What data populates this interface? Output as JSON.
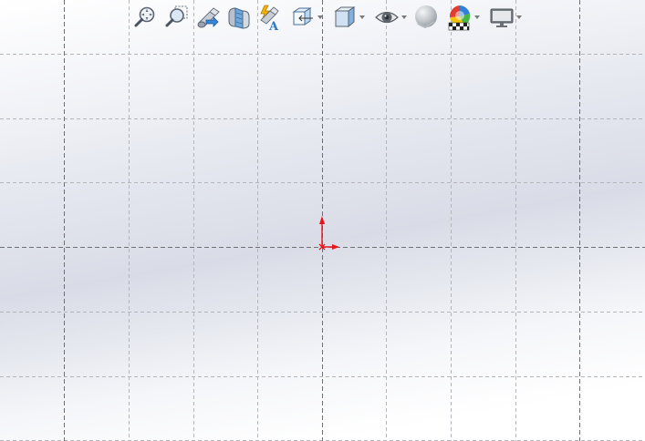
{
  "window": {
    "view": "sketch-graphics-area"
  },
  "heads_up_toolbar": {
    "items": [
      {
        "name": "zoom-to-fit",
        "icon": "zoom-fit-icon",
        "dropdown": false
      },
      {
        "name": "zoom-to-area",
        "icon": "zoom-area-icon",
        "dropdown": false
      },
      {
        "name": "previous-view",
        "icon": "previous-view-icon",
        "dropdown": false
      },
      {
        "name": "section-view",
        "icon": "section-view-icon",
        "dropdown": false
      },
      {
        "name": "dynamic-annotation-views",
        "icon": "dynamic-annotation-icon",
        "dropdown": false
      },
      {
        "name": "view-orientation",
        "icon": "view-orientation-icon",
        "dropdown": true
      },
      {
        "name": "display-style",
        "icon": "display-style-icon",
        "dropdown": true
      },
      {
        "name": "hide-show-items",
        "icon": "eye-icon",
        "dropdown": true
      },
      {
        "name": "edit-appearance",
        "icon": "appearance-sphere-icon",
        "dropdown": false
      },
      {
        "name": "apply-scene",
        "icon": "scene-icon",
        "dropdown": true
      },
      {
        "name": "view-settings",
        "icon": "monitor-icon",
        "dropdown": true
      }
    ]
  },
  "colors": {
    "grid_minor": "#b4b6bc",
    "grid_major": "#6e7076",
    "origin": "#e8141a",
    "background_light": "#ffffff",
    "background_mid": "#d9dce6"
  }
}
